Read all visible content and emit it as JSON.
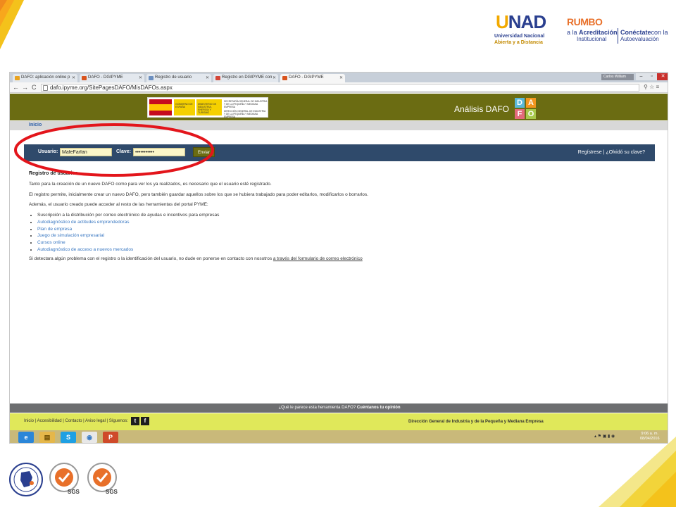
{
  "slide": {
    "unad": {
      "mark": "UNAD",
      "line1": "Universidad Nacional",
      "line2": "Abierta y a Distancia"
    },
    "rumbo": {
      "title": "RUMBO",
      "sub_prefix": "a la ",
      "sub_bold": "Acreditación",
      "sub2": "Institucional",
      "cx_bold": "Conéctate",
      "cx_rest": "con la",
      "cx2": "Autoevaluación"
    },
    "certs": [
      "SGS",
      "SGS"
    ]
  },
  "browser": {
    "tabs": [
      {
        "label": "DAFO: aplicación online p",
        "active": false
      },
      {
        "label": "DAFO - DGIPYME",
        "active": false
      },
      {
        "label": "Registro de usuario",
        "active": false
      },
      {
        "label": "Registro en DGIPYME con",
        "active": false
      },
      {
        "label": "DAFO - DGIPYME",
        "active": true
      }
    ],
    "user_chip": "Carlos William",
    "url": "dafo.ipyme.org/SitePagesDAFO/MisDAFOs.aspx"
  },
  "site": {
    "gob": {
      "gobierno": "GOBIERNO DE ESPAÑA",
      "ministerio": "MINISTERIO DE INDUSTRIA, ENERGÍA Y TURISMO",
      "secretaria": "SECRETARÍA GENERAL DE INDUSTRIA Y DE LA PEQUEÑA Y MEDIANA EMPRESA",
      "direccion": "DIRECCIÓN GENERAL DE INDUSTRIA Y DE LA PEQUEÑA Y MEDIANA EMPRESA"
    },
    "title": "Análisis DAFO",
    "dafo_letters": [
      "D",
      "A",
      "F",
      "O"
    ],
    "breadcrumb": "Inicio",
    "login": {
      "user_label": "Usuario:",
      "user_value": "MafeFarfan",
      "pass_label": "Clave:",
      "pass_value": "•••••••••••",
      "submit": "Enviar",
      "register": "Regístrese",
      "separator": "|",
      "forgot": "¿Olvidó su clave?"
    },
    "content": {
      "heading": "Registro de usuarios",
      "p1": "Tanto para la creación de un nuevo DAFO como para ver los ya realizados, es necesario que el usuario esté registrado.",
      "p2": "El registro permite, inicialmente crear un nuevo DAFO, pero también guardar aquellos sobre los que se hubiera trabajado para poder editarlos, modificarlos o borrarlos.",
      "p3": "Además, el usuario creado puede acceder al resto de las herramientas del portal PYME:",
      "tools": [
        {
          "label": "Suscripción a la distribución por correo electrónico de ayudas e incentivos para empresas",
          "link": false
        },
        {
          "label": "Autodiagnóstico de actitudes emprendedoras",
          "link": true
        },
        {
          "label": "Plan de empresa",
          "link": true
        },
        {
          "label": "Juego de simulación empresarial",
          "link": true
        },
        {
          "label": "Cursos online",
          "link": true
        },
        {
          "label": "Autodiagnóstico de acceso a nuevos mercados",
          "link": true
        }
      ],
      "p4": "Si detectara algún problema con el registro o la identificación del usuario, no dude en ponerse en contacto con nosotros ",
      "p4_link": "a través del formulario de correo electrónico"
    },
    "feedback": {
      "question": "¿Qué le parece esta herramienta DAFO? ",
      "cta": "Cuéntanos tu opinión"
    },
    "footer": {
      "links": "Inicio | Accesibilidad | Contacto | Aviso legal | Síguenos:",
      "twitter": "t",
      "facebook": "f",
      "right": "Dirección General de Industria y de la Pequeña y Mediana Empresa"
    }
  },
  "taskbar": {
    "apps": [
      "e",
      "▤",
      "S",
      "◉",
      "P"
    ],
    "time": "9:06 a. m.",
    "date": "08/04/2016"
  }
}
